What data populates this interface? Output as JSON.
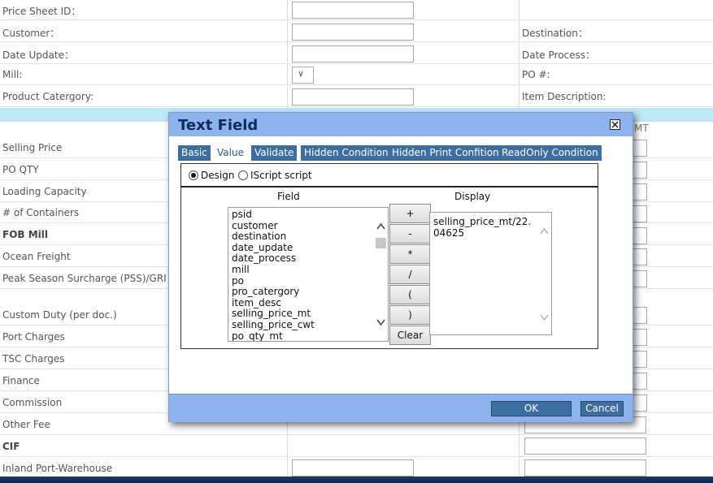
{
  "form": {
    "left_labels": [
      {
        "text": "Price Sheet ID：",
        "bold": false
      },
      {
        "text": "Customer：",
        "bold": false
      },
      {
        "text": "Date Update：",
        "bold": false
      },
      {
        "text": "Mill:",
        "bold": false
      },
      {
        "text": "Product Catergory:",
        "bold": false
      },
      {
        "text": "Selling Price",
        "bold": false
      },
      {
        "text": "PO QTY",
        "bold": false
      },
      {
        "text": "Loading Capacity",
        "bold": false
      },
      {
        "text": "# of Containers",
        "bold": false
      },
      {
        "text": "FOB Mill",
        "bold": true
      },
      {
        "text": "Ocean Freight",
        "bold": false
      },
      {
        "text": "Peak Season Surcharge (PSS)/GRI",
        "bold": false
      },
      {
        "text": "Custom Duty (per doc.)",
        "bold": false
      },
      {
        "text": "Port Charges",
        "bold": false
      },
      {
        "text": "TSC Charges",
        "bold": false
      },
      {
        "text": "Finance",
        "bold": false
      },
      {
        "text": "Commission",
        "bold": false
      },
      {
        "text": "Other Fee",
        "bold": false
      },
      {
        "text": "CIF",
        "bold": true
      },
      {
        "text": "Inland Port-Warehouse",
        "bold": false
      }
    ],
    "right_labels": [
      "Destination：",
      "Date Process：",
      "PO #:",
      "Item Description:"
    ],
    "mill_select_glyph": "∨",
    "unit_hint": "MT"
  },
  "dialog": {
    "title": "Text Field",
    "close_glyph": "×",
    "tabs": [
      {
        "label": "Basic",
        "active": false
      },
      {
        "label": "Value",
        "active": true
      },
      {
        "label": "Validate",
        "active": false
      },
      {
        "label": "Hidden Condition",
        "active": false
      },
      {
        "label": "Hidden Print Confition",
        "active": false
      },
      {
        "label": "ReadOnly Condition",
        "active": false
      }
    ],
    "mode": {
      "design_label": "Design",
      "script_label": "IScript script",
      "selected": "design"
    },
    "field_header": "Field",
    "display_header": "Display",
    "fields": [
      "psid",
      "customer",
      "destination",
      "date_update",
      "date_process",
      "mill",
      "po",
      "pro_catergory",
      "item_desc",
      "selling_price_mt",
      "selling_price_cwt",
      "po_qty_mt"
    ],
    "operators": [
      "+",
      "-",
      "*",
      "/",
      "(",
      ")",
      "Clear"
    ],
    "display_value": "selling_price_mt/22.04625",
    "ok_label": "OK",
    "cancel_label": "Cancel"
  },
  "colors": {
    "header_blue": "#8db3ef",
    "tab_blue": "#3d6ea1",
    "title_navy": "#10295a",
    "band_cyan": "#bfe8f7"
  }
}
